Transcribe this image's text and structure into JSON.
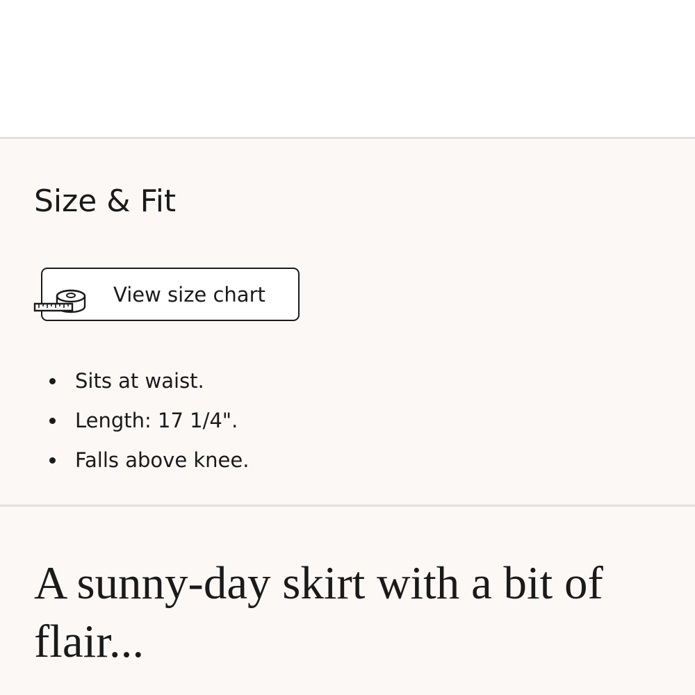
{
  "size_fit": {
    "title": "Size & Fit",
    "size_chart_button": {
      "label": "View size chart",
      "icon": "measuring-tape-icon"
    },
    "details": [
      "Sits at waist.",
      "Length: 17 1/4\".",
      "Falls above knee."
    ]
  },
  "description": {
    "headline": "A sunny-day skirt with a bit of flair..."
  },
  "colors": {
    "panel_background": "#fbf8f6",
    "divider": "#e2dfdc",
    "text": "#1a1a1a"
  }
}
